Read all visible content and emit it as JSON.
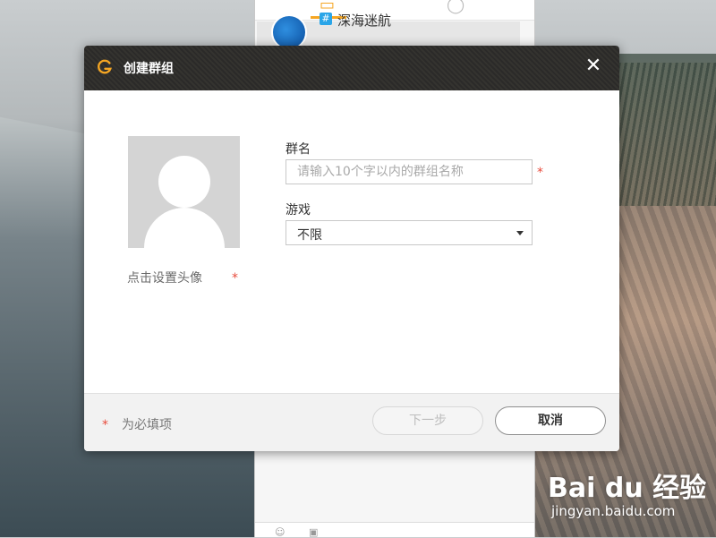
{
  "background_app": {
    "list_item_title": "深海迷航"
  },
  "dialog": {
    "title": "创建群组",
    "close_glyph": "✕",
    "avatar": {
      "label": "点击设置头像",
      "required_mark": "*"
    },
    "group_name": {
      "label": "群名",
      "value": "",
      "placeholder": "请输入10个字以内的群组名称",
      "required_mark": "*"
    },
    "game": {
      "label": "游戏",
      "selected": "不限"
    },
    "footer": {
      "required_mark": "*",
      "required_note": "为必填项",
      "next_label": "下一步",
      "cancel_label": "取消"
    }
  },
  "watermark": {
    "logo": "Bai du 经验",
    "url": "jingyan.baidu.com"
  },
  "colors": {
    "titlebar": "#2f2e2c",
    "accent_orange": "#f5a623",
    "required_red": "#e84b3c"
  }
}
